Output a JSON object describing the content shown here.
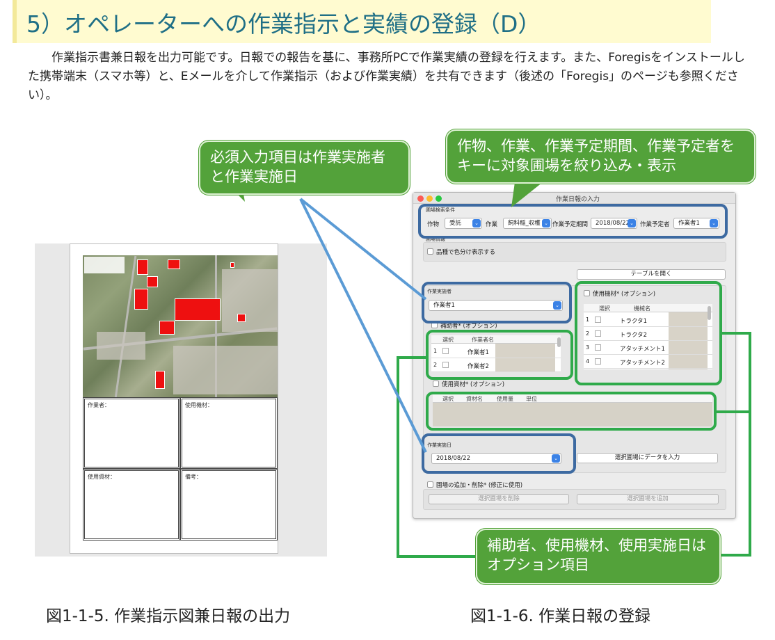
{
  "title": "5）オペレーターへの作業指示と実績の登録（D）",
  "intro": "作業指示書兼日報を出力可能です。日報での報告を基に、事務所PCで作業実績の登録を行えます。また、Foregisをインストールした携帯端末（スマホ等）と、Eメールを介して作業指示（および作業実績）を共有できます（後述の「Foregis」のページも参照ください）。",
  "callouts": {
    "required": "必須入力項目は作業実施者と作業実施日",
    "search": "作物、作業、作業予定期間、作業予定者をキーに対象圃場を絞り込み・表示",
    "optional": "補助者、使用機材、使用実施日はオプション項目"
  },
  "captions": {
    "left": "図1-1-5. 作業指示図兼日報の出力",
    "right": "図1-1-6. 作業日報の登録"
  },
  "report": {
    "cells": [
      "作業者：",
      "使用機材：",
      "使用資材：",
      "備考："
    ]
  },
  "dialog": {
    "window_title": "作業日報の入力",
    "search_group": "圃場検索条件",
    "crop_label": "作物",
    "crop_value": "受託",
    "work_label": "作業",
    "work_value": "飼料稲_収穫",
    "period_label": "作業予定期間",
    "period_value": "2018/08/22",
    "planner_label": "作業予定者",
    "planner_value": "作業者1",
    "field_info_group": "圃場情報",
    "variety_color_label": "品種で色分け表示する",
    "open_table_button": "テーブルを開く",
    "worker_group": "作業実施者",
    "worker_value": "作業者1",
    "helper_label": "補助者* (オプション)",
    "helper_headers": [
      "選択",
      "作業者名"
    ],
    "helpers": [
      {
        "num": "1",
        "name": "作業者1"
      },
      {
        "num": "2",
        "name": "作業者2"
      }
    ],
    "equipment_label": "使用機材* (オプション)",
    "equipment_headers": [
      "選択",
      "機械名"
    ],
    "equipment": [
      {
        "num": "1",
        "name": "トラクタ1"
      },
      {
        "num": "2",
        "name": "トラクタ2"
      },
      {
        "num": "3",
        "name": "アタッチメント1"
      },
      {
        "num": "4",
        "name": "アタッチメント2"
      }
    ],
    "material_label": "使用資材* (オプション)",
    "material_headers": [
      "選択",
      "資材名",
      "使用量",
      "単位"
    ],
    "date_group": "作業実施日",
    "date_value": "2018/08/22",
    "input_button": "選択圃場にデータを入力",
    "addremove_label": "圃場の追加・削除* (修正に使用)",
    "remove_button": "選択圃場を削除",
    "add_button": "選択圃場を追加"
  }
}
